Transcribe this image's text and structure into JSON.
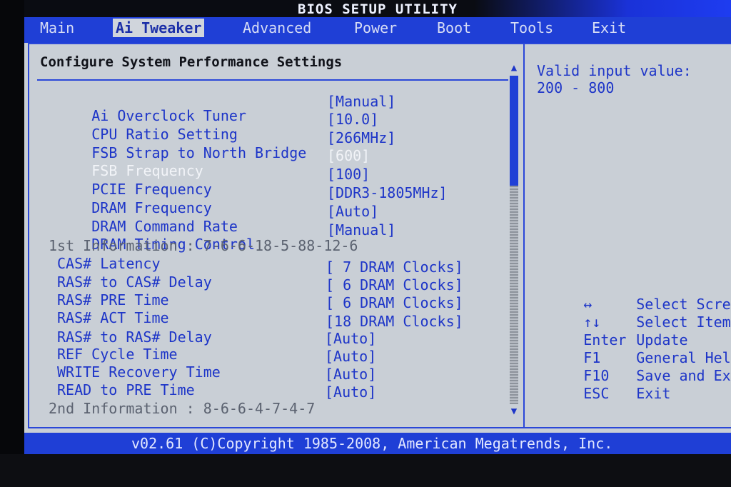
{
  "window": {
    "title": "BIOS SETUP UTILITY"
  },
  "menu": {
    "items": [
      {
        "label": "Main"
      },
      {
        "label": "Ai Tweaker",
        "active": true
      },
      {
        "label": "Advanced"
      },
      {
        "label": "Power"
      },
      {
        "label": "Boot"
      },
      {
        "label": "Tools"
      },
      {
        "label": "Exit"
      }
    ]
  },
  "main": {
    "section_title": "Configure System Performance Settings",
    "settings": [
      {
        "label": "Ai Overclock Tuner",
        "value": "[Manual]"
      },
      {
        "label": "CPU Ratio Setting",
        "value": "[10.0]"
      },
      {
        "label": "FSB Strap to North Bridge",
        "value": "[266MHz]"
      },
      {
        "label": "FSB Frequency",
        "value": "[600]",
        "selected": true
      },
      {
        "label": "PCIE Frequency",
        "value": "[100]"
      },
      {
        "label": "DRAM Frequency",
        "value": "[DDR3-1805MHz]"
      },
      {
        "label": "DRAM Command Rate",
        "value": "[Auto]"
      },
      {
        "label": "DRAM Timing Control",
        "value": "[Manual]"
      }
    ],
    "info1": "1st Information : 7-6-6-18-5-88-12-6",
    "timings": [
      {
        "label": "CAS# Latency",
        "value": "[ 7 DRAM Clocks]"
      },
      {
        "label": "RAS# to CAS# Delay",
        "value": "[ 6 DRAM Clocks]"
      },
      {
        "label": "RAS# PRE Time",
        "value": "[ 6 DRAM Clocks]"
      },
      {
        "label": "RAS# ACT Time",
        "value": "[18 DRAM Clocks]"
      },
      {
        "label": "RAS# to RAS# Delay",
        "value": "[Auto]"
      },
      {
        "label": "REF Cycle Time",
        "value": "[Auto]"
      },
      {
        "label": "WRITE Recovery Time",
        "value": "[Auto]"
      },
      {
        "label": "READ to PRE Time",
        "value": "[Auto]"
      }
    ],
    "info2": "2nd Information : 8-6-6-4-7-4-7"
  },
  "help": {
    "line1": "Valid input value:",
    "line2": "200 - 800",
    "keys": [
      {
        "key": "↔",
        "desc": "Select Screen"
      },
      {
        "key": "↑↓",
        "desc": "Select Item"
      },
      {
        "key": "Enter",
        "desc": "Update"
      },
      {
        "key": "F1",
        "desc": "General Help"
      },
      {
        "key": "F10",
        "desc": "Save and Exit"
      },
      {
        "key": "ESC",
        "desc": "Exit"
      }
    ]
  },
  "footer": {
    "text": "v02.61 (C)Copyright 1985-2008, American Megatrends, Inc."
  },
  "icons": {
    "scroll_up": "triangle-up",
    "scroll_down": "triangle-down"
  },
  "colors": {
    "menu_bar": "#1f3fd6",
    "panel_bg": "#c9cfd6",
    "setting_text": "#1d35c8",
    "selected_text": "#f2f4f8",
    "info_text": "#5b6270"
  }
}
